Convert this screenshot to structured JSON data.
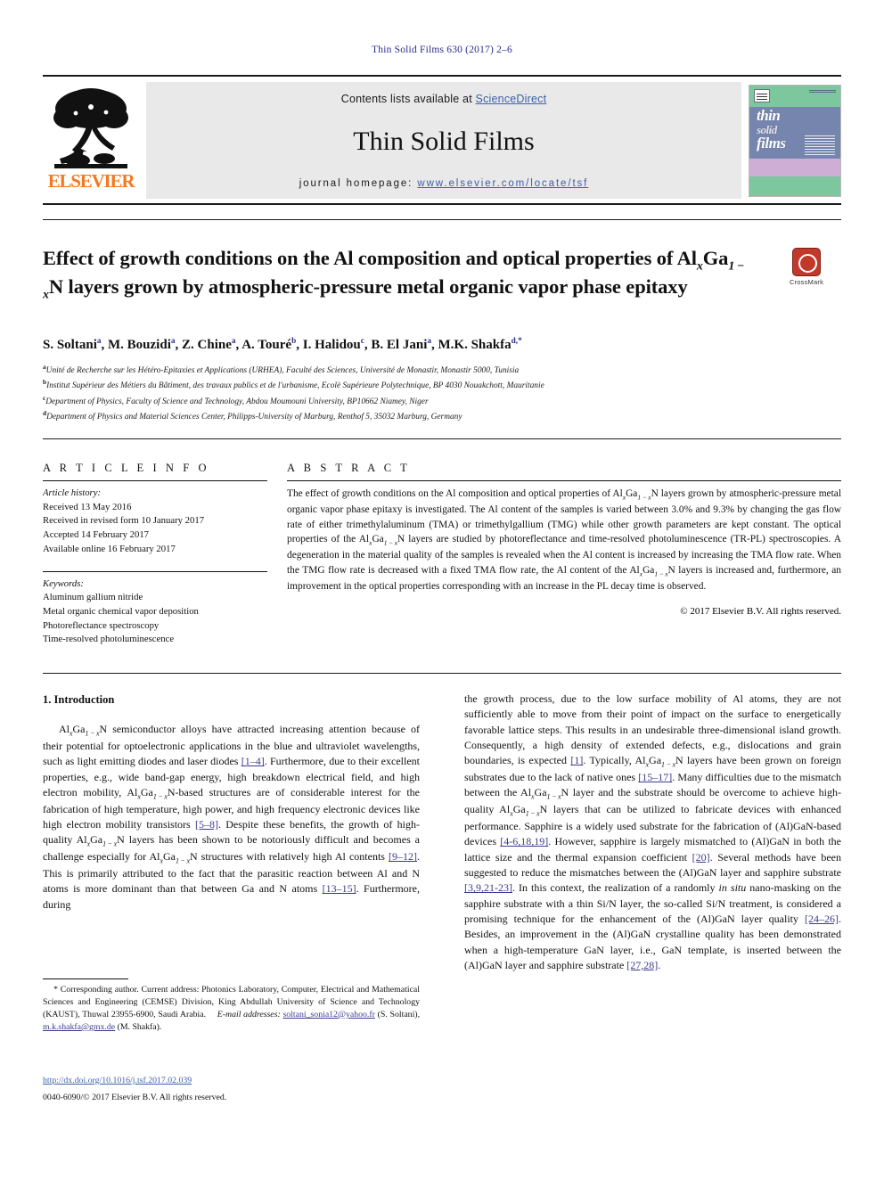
{
  "running_head": "Thin Solid Films 630 (2017) 2–6",
  "masthead": {
    "contents_prefix": "Contents lists available at ",
    "sciencedirect": "ScienceDirect",
    "journal_title": "Thin Solid Films",
    "homepage_prefix": "journal homepage: ",
    "homepage_url": "www.elsevier.com/locate/tsf",
    "publisher": "ELSEVIER",
    "publisher_color": "#f47920",
    "cover_line1": "thin",
    "cover_line2": "solid",
    "cover_line3": "films"
  },
  "crossmark": {
    "label": "CrossMark",
    "badge_color": "#c0392b"
  },
  "title": {
    "line1": "Effect of growth conditions on the Al composition and optical properties",
    "line2_a": "of Al",
    "line2_sub1": "x",
    "line2_b": "Ga",
    "line2_sub2": "1 − x",
    "line2_c": "N layers grown by atmospheric-pressure metal organic vapor",
    "line3": "phase epitaxy"
  },
  "authors": [
    {
      "name": "S. Soltani",
      "sup": "a"
    },
    {
      "name": "M. Bouzidi",
      "sup": "a"
    },
    {
      "name": "Z. Chine",
      "sup": "a"
    },
    {
      "name": "A. Touré",
      "sup": "b"
    },
    {
      "name": "I. Halidou",
      "sup": "c"
    },
    {
      "name": "B. El Jani",
      "sup": "a"
    },
    {
      "name": "M.K. Shakfa",
      "sup": "d,*"
    }
  ],
  "affiliations": [
    {
      "mark": "a",
      "text": "Unité de Recherche sur les Hétéro-Epitaxies et Applications (URHEA), Faculté des Sciences, Université de Monastir, Monastir 5000, Tunisia"
    },
    {
      "mark": "b",
      "text": "Institut Supérieur des Métiers du Bâtiment, des travaux publics et de l'urbanisme, Ecolè Supérieure Polytechnique, BP 4030 Nouakchott, Mauritanie"
    },
    {
      "mark": "c",
      "text": "Department of Physics, Faculty of Science and Technology, Abdou Moumouni University, BP10662 Niamey, Niger"
    },
    {
      "mark": "d",
      "text": "Department of Physics and Material Sciences Center, Philipps-University of Marburg, Renthof 5, 35032 Marburg, Germany"
    }
  ],
  "article_info": {
    "heading": "A R T I C L E    I N F O",
    "history_label": "Article history:",
    "history": [
      "Received 13 May 2016",
      "Received in revised form 10 January 2017",
      "Accepted 14 February 2017",
      "Available online 16 February 2017"
    ],
    "keywords_label": "Keywords:",
    "keywords": [
      "Aluminum gallium nitride",
      "Metal organic chemical vapor deposition",
      "Photoreflectance spectroscopy",
      "Time-resolved photoluminescence"
    ]
  },
  "abstract": {
    "heading": "A B S T R A C T",
    "p1_a": "The effect of growth conditions on the Al composition and optical properties of Al",
    "p1_sub1": "x",
    "p1_b": "Ga",
    "p1_sub2": "1 − x",
    "p1_c": "N layers grown by atmospheric-pressure metal organic vapor phase epitaxy is investigated. The Al content of the samples is varied between 3.0% and 9.3% by changing the gas flow rate of either trimethylaluminum (TMA) or trimethylgallium (TMG) while other growth parameters are kept constant. The optical properties of the Al",
    "p1_sub3": "x",
    "p1_d": "Ga",
    "p1_sub4": "1 − x",
    "p1_e": "N layers are studied by photoreflectance and time-resolved photoluminescence (TR-PL) spectroscopies. A degeneration in the material quality of the samples is revealed when the Al content is increased by increasing the TMA flow rate. When the TMG flow rate is decreased with a fixed TMA flow rate, the Al content of the Al",
    "p1_sub5": "x",
    "p1_f": "Ga",
    "p1_sub6": "1 − x",
    "p1_g": "N layers is increased and, furthermore, an improvement in the optical properties corresponding with an increase in the PL decay time is observed.",
    "copyright": "© 2017 Elsevier B.V. All rights reserved."
  },
  "body": {
    "section_title": "1. Introduction",
    "left_p1_a": "Al",
    "left_p1_sub1": "x",
    "left_p1_b": "Ga",
    "left_p1_sub2": "1 − x",
    "left_p1_c": "N semiconductor alloys have attracted increasing attention because of their potential for optoelectronic applications in the blue and ultraviolet wavelengths, such as light emitting diodes and laser diodes ",
    "ref_1_4": "[1–4]",
    "left_p1_d": ". Furthermore, due to their excellent properties, e.g., wide band-gap energy, high breakdown electrical field, and high electron mobility, Al",
    "left_p1_sub3": "x",
    "left_p1_e": "Ga",
    "left_p1_sub4": "1 − x",
    "left_p1_f": "N-based structures are of considerable interest for the fabrication of high temperature, high power, and high frequency electronic devices like high electron mobility transistors ",
    "ref_5_8": "[5–8]",
    "left_p1_g": ". Despite these benefits, the growth of high-quality Al",
    "left_p1_sub5": "x",
    "left_p1_h": "Ga",
    "left_p1_sub6": "1 − x",
    "left_p1_i": "N layers has been shown to be notoriously difficult and becomes a challenge especially for Al",
    "left_p1_sub7": "x",
    "left_p1_j": "Ga",
    "left_p1_sub8": "1 − x",
    "left_p1_k": "N structures with relatively high Al contents ",
    "ref_9_12": "[9–12]",
    "left_p1_l": ". This is primarily attributed to the fact that the parasitic reaction between Al and N atoms is more dominant than that between Ga and N atoms ",
    "ref_13_15": "[13–15]",
    "left_p1_m": ". Furthermore, during",
    "right_p1_a": "the growth process, due to the low surface mobility of Al atoms, they are not sufficiently able to move from their point of impact on the surface to energetically favorable lattice steps. This results in an undesirable three-dimensional island growth. Consequently, a high density of extended defects, e.g., dislocations and grain boundaries, is expected ",
    "ref_1": "[1]",
    "right_p1_b": ". Typically, Al",
    "right_p1_sub1": "x",
    "right_p1_c": "Ga",
    "right_p1_sub2": "1 − x",
    "right_p1_d": "N layers have been grown on foreign substrates due to the lack of native ones ",
    "ref_15_17": "[15–17]",
    "right_p1_e": ". Many difficulties due to the mismatch between the Al",
    "right_p1_sub3": "x",
    "right_p1_f": "Ga",
    "right_p1_sub4": "1 − x",
    "right_p1_g": "N layer and the substrate should be overcome to achieve high-quality Al",
    "right_p1_sub5": "x",
    "right_p1_h": "Ga",
    "right_p1_sub6": "1 − x",
    "right_p1_i": "N layers that can be utilized to fabricate devices with enhanced performance. Sapphire is a widely used substrate for the fabrication of (Al)GaN-based devices ",
    "ref_4_6_18_19": "[4-6,18,19]",
    "right_p1_j": ". However, sapphire is largely mismatched to (Al)GaN in both the lattice size and the thermal expansion coefficient ",
    "ref_20": "[20]",
    "right_p1_k": ". Several methods have been suggested to reduce the mismatches between the (Al)GaN layer and sapphire substrate ",
    "ref_3_9_21_23": "[3,9,21-23]",
    "right_p1_l": ". In this context, the realization of a randomly ",
    "right_p1_italic": "in situ",
    "right_p1_m": " nano-masking on the sapphire substrate with a thin Si/N layer, the so-called Si/N treatment, is considered a promising technique for the enhancement of the (Al)GaN layer quality ",
    "ref_24_26": "[24–26]",
    "right_p1_n": ". Besides, an improvement in the (Al)GaN crystalline quality has been demonstrated when a high-temperature GaN layer, i.e., GaN template, is inserted between the (Al)GaN layer and sapphire substrate ",
    "ref_27_28": "[27,28]",
    "right_p1_o": "."
  },
  "footnote": {
    "star": "*",
    "corresponding": " Corresponding author. Current address: Photonics Laboratory, Computer, Electrical and Mathematical Sciences and Engineering (CEMSE) Division, King Abdullah University of Science and Technology (KAUST), Thuwal 23955-6900, Saudi Arabia.",
    "email_label": "E-mail addresses:",
    "email1": "soltani_sonia12@yahoo.fr",
    "email1_who": " (S. Soltani), ",
    "email2": "m.k.shakfa@gmx.de",
    "email2_who": " (M. Shakfa)."
  },
  "footer": {
    "doi": "http://dx.doi.org/10.1016/j.tsf.2017.02.039",
    "copyright": "0040-6090/© 2017 Elsevier B.V. All rights reserved."
  }
}
